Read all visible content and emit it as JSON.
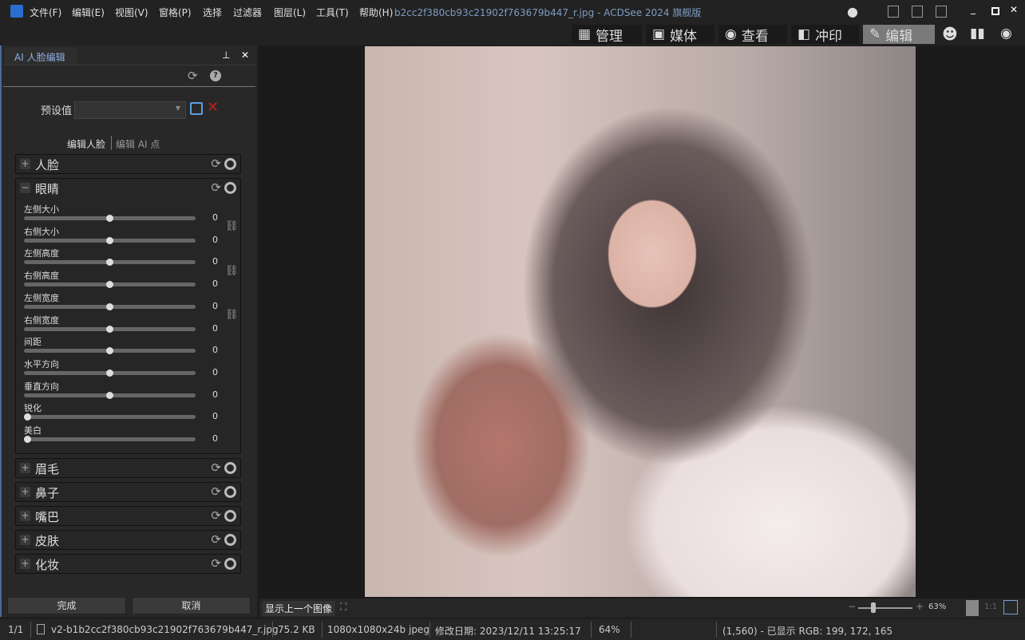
{
  "window": {
    "title": "b2cc2f380cb93c21902f763679b447_r.jpg - ACDSee 2024 旗舰版"
  },
  "menu": [
    "文件(F)",
    "编辑(E)",
    "视图(V)",
    "窗格(P)",
    "选择",
    "过滤器",
    "图层(L)",
    "工具(T)",
    "帮助(H)"
  ],
  "modes": [
    {
      "label": "管理",
      "icon": "grid-icon"
    },
    {
      "label": "媒体",
      "icon": "media-icon"
    },
    {
      "label": "查看",
      "icon": "eye-icon"
    },
    {
      "label": "冲印",
      "icon": "develop-icon"
    },
    {
      "label": "编辑",
      "icon": "edit-icon",
      "active": true
    }
  ],
  "panel": {
    "tab": "AI 人脸编辑",
    "preset_label": "预设值",
    "preset_value": "",
    "subtabs": [
      "编辑人脸",
      "编辑 AI 点"
    ],
    "sections": [
      "人脸",
      "眼睛",
      "眉毛",
      "鼻子",
      "嘴巴",
      "皮肤",
      "化妆"
    ],
    "eye_sliders": [
      {
        "label": "左侧大小",
        "value": "0",
        "position": 0.5
      },
      {
        "label": "右侧大小",
        "value": "0",
        "position": 0.5
      },
      {
        "label": "左侧高度",
        "value": "0",
        "position": 0.5
      },
      {
        "label": "右侧高度",
        "value": "0",
        "position": 0.5
      },
      {
        "label": "左侧宽度",
        "value": "0",
        "position": 0.5
      },
      {
        "label": "右侧宽度",
        "value": "0",
        "position": 0.5
      },
      {
        "label": "间距",
        "value": "0",
        "position": 0.5
      },
      {
        "label": "水平方向",
        "value": "0",
        "position": 0.5
      },
      {
        "label": "垂直方向",
        "value": "0",
        "position": 0.5
      },
      {
        "label": "锐化",
        "value": "0",
        "position": 0
      },
      {
        "label": "美白",
        "value": "0",
        "position": 0
      }
    ],
    "done": "完成",
    "cancel": "取消"
  },
  "viewer": {
    "prev_image": "显示上一个图像",
    "zoom": "63%",
    "ratio": "1:1"
  },
  "status": {
    "index": "1/1",
    "filename": "v2-b1b2cc2f380cb93c21902f763679b447_r.jpg",
    "size": "75.2 KB",
    "dims": "1080x1080x24b jpeg",
    "modified": "修改日期: 2023/12/11 13:25:17",
    "zoom": "64%",
    "pixel": "(1,560) - 已显示 RGB: 199, 172, 165"
  }
}
